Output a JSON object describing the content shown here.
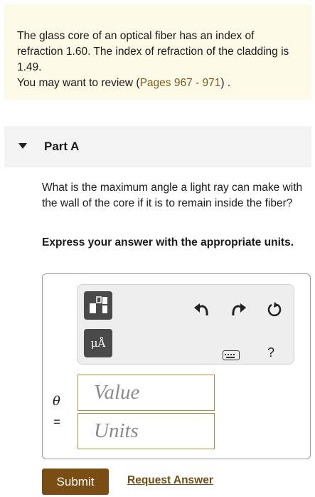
{
  "problem": {
    "text": "The glass core of an optical fiber has an index of refraction 1.60. The index of refraction of the cladding is 1.49.",
    "review_prefix": "You may want to review (",
    "review_link": "Pages 967 - 971",
    "review_suffix": ") ."
  },
  "part": {
    "title": "Part A",
    "question": "What is the maximum angle a light ray can make with the wall of the core if it is to remain inside the fiber?",
    "instruction": "Express your answer with the appropriate units."
  },
  "toolbar": {
    "units_button_label": "μÅ",
    "help_label": "?",
    "icons": [
      "template-icon",
      "units-icon",
      "undo-icon",
      "redo-icon",
      "reset-icon",
      "keyboard-icon"
    ]
  },
  "answer": {
    "variable": "θ",
    "equals": "=",
    "value_placeholder": "Value",
    "units_placeholder": "Units"
  },
  "actions": {
    "submit_label": "Submit",
    "request_answer_label": "Request Answer"
  },
  "colors": {
    "intro_bg": "#fdfbe7",
    "link": "#7a5b1e",
    "submit_bg": "#7a4d14",
    "field_border": "#b38b3a"
  }
}
